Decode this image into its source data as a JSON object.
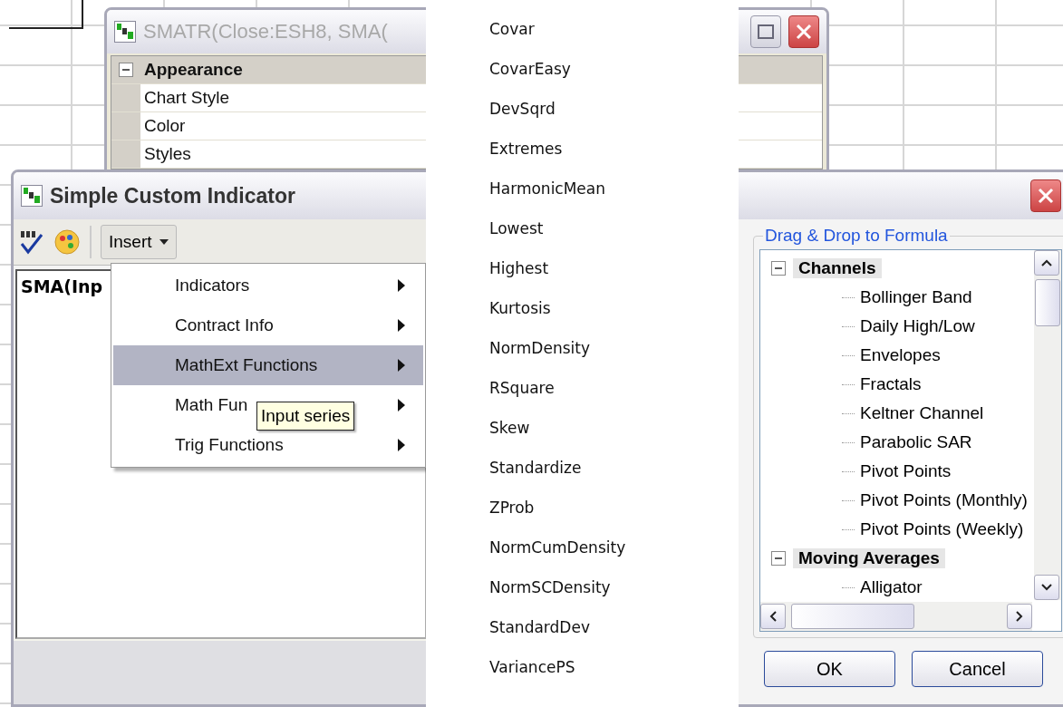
{
  "back_window": {
    "title": "SMATR(Close:ESH8, SMA(",
    "property_grid": {
      "category": {
        "label": "Appearance",
        "expanded": true
      },
      "rows": [
        {
          "label": "Chart Style"
        },
        {
          "label": "Color"
        },
        {
          "label": "Styles"
        }
      ]
    }
  },
  "front_window": {
    "title": "Simple Custom Indicator",
    "insert_button": "Insert",
    "editor": {
      "value": "SMA(Inp"
    },
    "group_title": "Drag & Drop to Formula",
    "tree": [
      {
        "label": "Channels",
        "expanded": true,
        "children": [
          {
            "label": "Bollinger Band"
          },
          {
            "label": "Daily High/Low"
          },
          {
            "label": "Envelopes"
          },
          {
            "label": "Fractals"
          },
          {
            "label": "Keltner Channel"
          },
          {
            "label": "Parabolic SAR"
          },
          {
            "label": "Pivot Points"
          },
          {
            "label": "Pivot Points (Monthly)"
          },
          {
            "label": "Pivot Points (Weekly)"
          }
        ]
      },
      {
        "label": "Moving Averages",
        "expanded": true,
        "children": [
          {
            "label": "Alligator"
          }
        ]
      }
    ],
    "buttons": [
      "OK",
      "Cancel"
    ]
  },
  "insert_menu": {
    "items": [
      {
        "label": "Indicators",
        "selected": false
      },
      {
        "label": "Contract Info",
        "selected": false
      },
      {
        "label": "MathExt Functions",
        "selected": true
      },
      {
        "label": "Math Fun",
        "selected": false
      },
      {
        "label": "Trig Functions",
        "selected": false
      }
    ]
  },
  "tooltip": "Input series",
  "submenu": {
    "items": [
      "Covar",
      "CovarEasy",
      "DevSqrd",
      "Extremes",
      "HarmonicMean",
      "Lowest",
      "Highest",
      "Kurtosis",
      "NormDensity",
      "RSquare",
      "Skew",
      "Standardize",
      "ZProb",
      "NormCumDensity",
      "NormSCDensity",
      "StandardDev",
      "VariancePS"
    ]
  }
}
